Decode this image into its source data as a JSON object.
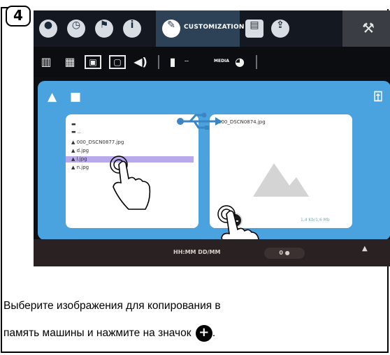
{
  "step": {
    "number": "4"
  },
  "topbar": {
    "icons": [
      "drop-icon",
      "clock-icon",
      "flag-icon",
      "info-icon",
      "pencil-icon",
      "document-icon",
      "upload-person-icon",
      "wrench-icon"
    ],
    "active_label": "CUSTOMIZATION",
    "active_color": "#2e4257"
  },
  "subbar": {
    "icons": [
      "book-icon",
      "book-open-icon",
      "picture-frame-icon",
      "screen-icon",
      "speaker-icon",
      "usb-drive-icon",
      "palette-icon"
    ],
    "media_label": "MEDIA"
  },
  "panel": {
    "accent_color": "#4aa3de",
    "tabs": [
      "image-tab-icon",
      "video-tab-icon"
    ],
    "files": [
      {
        "name": "",
        "type": "folder",
        "selected": false
      },
      {
        "name": "..",
        "type": "folder",
        "selected": false
      },
      {
        "name": "000_DSCN0877.jpg",
        "type": "image",
        "selected": false
      },
      {
        "name": "d.jpg",
        "type": "image",
        "selected": false
      },
      {
        "name": "l.jpg",
        "type": "image",
        "selected": true
      },
      {
        "name": "n.jpg",
        "type": "image",
        "selected": false
      }
    ],
    "selected_color": "#b8a8ec",
    "preview_filename": "000_DSCN0874.jpg",
    "preview_size": "1,4 Kb/1,6 Mb"
  },
  "bottombar": {
    "time": "HH:MM DD/MM",
    "pill_text": "0 ●"
  },
  "instruction": {
    "line1": "Выберите изображения для копирования в",
    "line2": "память машины и нажмите на значок",
    "line2_end": "."
  }
}
